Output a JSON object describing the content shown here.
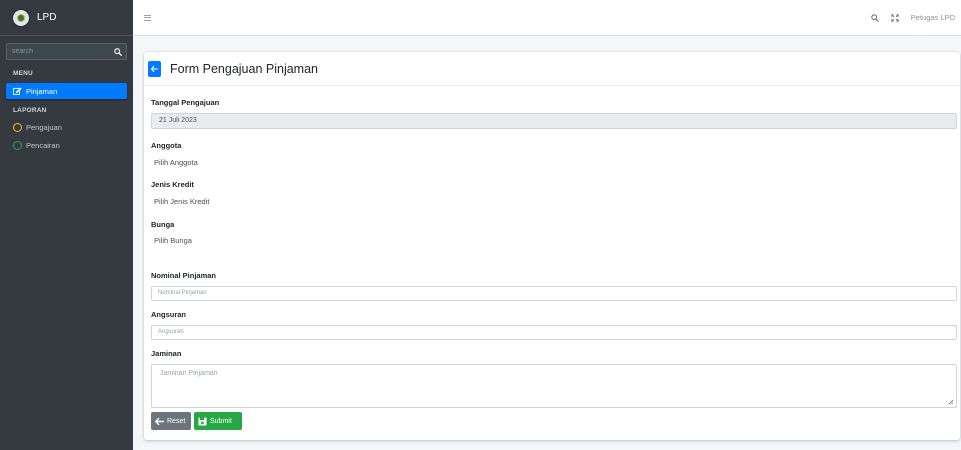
{
  "brand": {
    "name": "LPD"
  },
  "sidebar": {
    "search_placeholder": "search",
    "menu_header": "MENU",
    "items": [
      {
        "label": "Pinjaman",
        "icon": "edit-icon",
        "active": true
      }
    ],
    "laporan_header": "LAPORAN",
    "laporan_items": [
      {
        "label": "Pengajuan",
        "icon": "circle-icon",
        "color": "#ffc107"
      },
      {
        "label": "Pencairan",
        "icon": "circle-icon",
        "color": "#28a745"
      }
    ]
  },
  "topbar": {
    "user_name": "Petugas LPD"
  },
  "form": {
    "title": "Form Pengajuan Pinjaman",
    "tanggal_label": "Tanggal Pengajuan",
    "tanggal_value": "21 Juli 2023",
    "anggota_label": "Anggota",
    "anggota_value": "Pilih Anggota",
    "jenis_label": "Jenis Kredit",
    "jenis_value": "Pilih Jenis Kredit",
    "bunga_label": "Bunga",
    "bunga_value": "Pilih Bunga",
    "nominal_label": "Nominal Pinjaman",
    "nominal_placeholder": "Nominal Pinjaman",
    "angsuran_label": "Angsuran",
    "angsuran_placeholder": "Angsuran",
    "jaminan_label": "Jaminan",
    "jaminan_placeholder": "Jaminan Pinjaman",
    "reset_label": "Reset",
    "submit_label": "Submit"
  },
  "colors": {
    "sidebar_bg": "#343a40",
    "primary": "#007bff",
    "success": "#28a745",
    "secondary": "#6c757d",
    "warning": "#ffc107"
  }
}
